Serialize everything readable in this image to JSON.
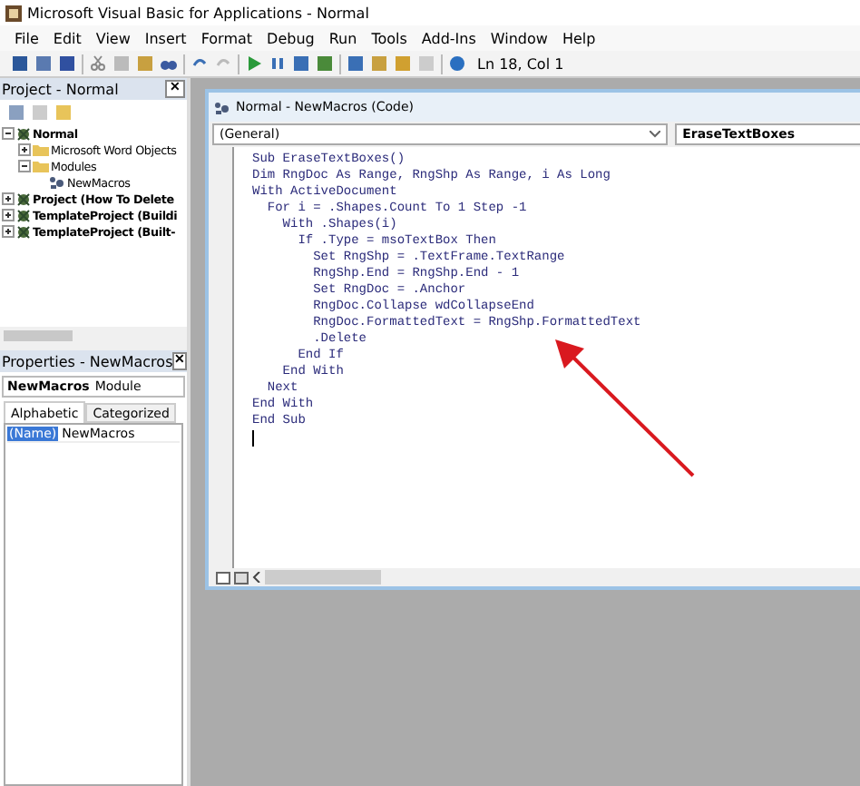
{
  "window": {
    "title": "Microsoft Visual Basic for Applications - Normal"
  },
  "menu": [
    "File",
    "Edit",
    "View",
    "Insert",
    "Format",
    "Debug",
    "Run",
    "Tools",
    "Add-Ins",
    "Window",
    "Help"
  ],
  "toolbar": {
    "position": "Ln 18, Col 1"
  },
  "project_pane": {
    "title": "Project - Normal",
    "close": "✕",
    "tree": [
      {
        "label": "Normal",
        "bold": true,
        "expanded": true,
        "kind": "project",
        "children": [
          {
            "label": "Microsoft Word Objects",
            "bold": false,
            "expanded": false,
            "kind": "folder"
          },
          {
            "label": "Modules",
            "bold": false,
            "expanded": true,
            "kind": "folder",
            "children": [
              {
                "label": "NewMacros",
                "bold": false,
                "kind": "module"
              }
            ]
          }
        ]
      },
      {
        "label": "Project (How To Delete",
        "bold": true,
        "expanded": false,
        "kind": "project"
      },
      {
        "label": "TemplateProject (Buildi",
        "bold": true,
        "expanded": false,
        "kind": "project"
      },
      {
        "label": "TemplateProject (Built-",
        "bold": true,
        "expanded": false,
        "kind": "project"
      }
    ]
  },
  "properties_pane": {
    "title": "Properties - NewMacros",
    "close": "✕",
    "object_name": "NewMacros",
    "object_type": "Module",
    "tabs": [
      {
        "label": "Alphabetic",
        "selected": true
      },
      {
        "label": "Categorized",
        "selected": false
      }
    ],
    "rows": [
      {
        "name": "(Name)",
        "value": "NewMacros",
        "selected": true
      }
    ]
  },
  "code_window": {
    "title": "Normal - NewMacros (Code)",
    "object_combo": "(General)",
    "procedure_combo": "EraseTextBoxes",
    "lines": [
      "Sub EraseTextBoxes()",
      "Dim RngDoc As Range, RngShp As Range, i As Long",
      "With ActiveDocument",
      "  For i = .Shapes.Count To 1 Step -1",
      "    With .Shapes(i)",
      "      If .Type = msoTextBox Then",
      "        Set RngShp = .TextFrame.TextRange",
      "        RngShp.End = RngShp.End - 1",
      "        Set RngDoc = .Anchor",
      "        RngDoc.Collapse wdCollapseEnd",
      "        RngDoc.FormattedText = RngShp.FormattedText",
      "        .Delete",
      "      End If",
      "    End With",
      "  Next",
      "End With",
      "End Sub"
    ]
  }
}
